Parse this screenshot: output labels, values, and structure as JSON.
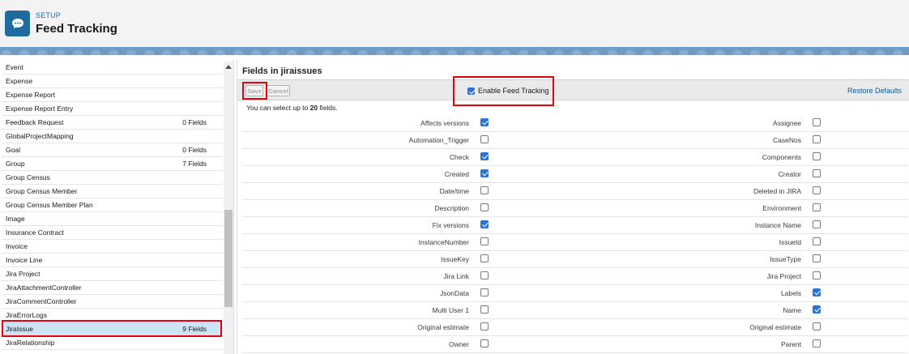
{
  "header": {
    "section_label": "SETUP",
    "title": "Feed Tracking",
    "icon": "chat-bubble-icon"
  },
  "objects": [
    {
      "name": "Event",
      "fields": ""
    },
    {
      "name": "Expense",
      "fields": ""
    },
    {
      "name": "Expense Report",
      "fields": ""
    },
    {
      "name": "Expense Report Entry",
      "fields": ""
    },
    {
      "name": "Feedback Request",
      "fields": "0 Fields"
    },
    {
      "name": "GlobalProjectMapping",
      "fields": ""
    },
    {
      "name": "Goal",
      "fields": "0 Fields"
    },
    {
      "name": "Group",
      "fields": "7 Fields"
    },
    {
      "name": "Group Census",
      "fields": ""
    },
    {
      "name": "Group Census Member",
      "fields": ""
    },
    {
      "name": "Group Census Member Plan",
      "fields": ""
    },
    {
      "name": "Image",
      "fields": ""
    },
    {
      "name": "Insurance Contract",
      "fields": ""
    },
    {
      "name": "Invoice",
      "fields": ""
    },
    {
      "name": "Invoice Line",
      "fields": ""
    },
    {
      "name": "Jira Project",
      "fields": ""
    },
    {
      "name": "JiraAttachmentController",
      "fields": ""
    },
    {
      "name": "JiraCommentController",
      "fields": ""
    },
    {
      "name": "JiraErrorLogs",
      "fields": ""
    },
    {
      "name": "JiraIssue",
      "fields": "9 Fields",
      "selected": true
    },
    {
      "name": "JiraRelationship",
      "fields": ""
    }
  ],
  "panel": {
    "title": "Fields in jiraissues",
    "save_label": "Save",
    "cancel_label": "Cancel",
    "enable_label": "Enable Feed Tracking",
    "enable_checked": true,
    "restore_label": "Restore Defaults",
    "hint_prefix": "You can select up to ",
    "hint_count": "20",
    "hint_suffix": " fields."
  },
  "fields": [
    {
      "left": "Affects versions",
      "left_checked": true,
      "right": "Assignee",
      "right_checked": false
    },
    {
      "left": "Automation_Trigger",
      "left_checked": false,
      "right": "CaseNos",
      "right_checked": false
    },
    {
      "left": "Check",
      "left_checked": true,
      "right": "Components",
      "right_checked": false
    },
    {
      "left": "Created",
      "left_checked": true,
      "right": "Creator",
      "right_checked": false
    },
    {
      "left": "Date/time",
      "left_checked": false,
      "right": "Deleted in JIRA",
      "right_checked": false
    },
    {
      "left": "Description",
      "left_checked": false,
      "right": "Environment",
      "right_checked": false
    },
    {
      "left": "Fix versions",
      "left_checked": true,
      "right": "Instance Name",
      "right_checked": false
    },
    {
      "left": "InstanceNumber",
      "left_checked": false,
      "right": "IssueId",
      "right_checked": false
    },
    {
      "left": "IssueKey",
      "left_checked": false,
      "right": "IssueType",
      "right_checked": false
    },
    {
      "left": "Jira Link",
      "left_checked": false,
      "right": "Jira Project",
      "right_checked": false
    },
    {
      "left": "JsonData",
      "left_checked": false,
      "right": "Labels",
      "right_checked": true
    },
    {
      "left": "Multi User 1",
      "left_checked": false,
      "right": "Name",
      "right_checked": true
    },
    {
      "left": "Original estimate",
      "left_checked": false,
      "right": "Original estimate",
      "right_checked": false
    },
    {
      "left": "Owner",
      "left_checked": false,
      "right": "Parent",
      "right_checked": false
    }
  ],
  "colors": {
    "brand_icon": "#1f6b9e",
    "highlight": "#e8000b",
    "selected_row": "#cde4f6",
    "checkbox": "#2b73d6",
    "link": "#0a5aa8"
  }
}
